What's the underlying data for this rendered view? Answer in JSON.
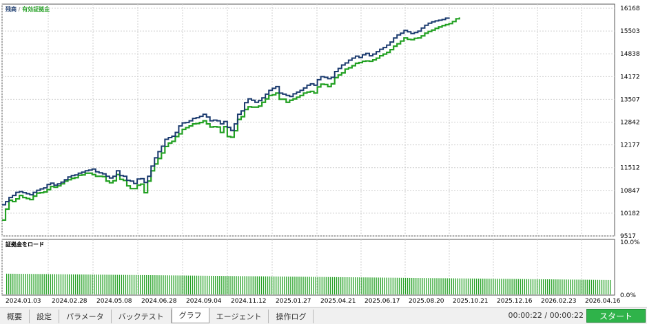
{
  "legend": {
    "balance": "残高",
    "separator": "/",
    "equity": "有効証拠金"
  },
  "load_title": "証拠金をロード",
  "tabs": [
    {
      "label": "概要",
      "active": false
    },
    {
      "label": "設定",
      "active": false
    },
    {
      "label": "パラメータ",
      "active": false
    },
    {
      "label": "バックテスト",
      "active": false
    },
    {
      "label": "グラフ",
      "active": true
    },
    {
      "label": "エージェント",
      "active": false
    },
    {
      "label": "操作ログ",
      "active": false
    }
  ],
  "timer": "00:00:22 / 00:00:22",
  "start_label": "スタート",
  "colors": {
    "balance": "#1a3a6e",
    "equity": "#22a022",
    "grid": "#cfcfcf",
    "load_bar": "#22a022",
    "start_button": "#2fb34a"
  },
  "chart_data": [
    {
      "type": "line",
      "series": [
        {
          "name": "残高",
          "role": "balance"
        },
        {
          "name": "有効証拠金",
          "role": "equity"
        }
      ],
      "y_ticks": [
        9517,
        10182,
        10847,
        11512,
        12177,
        12842,
        13507,
        14172,
        14838,
        15503,
        16168
      ],
      "ylim": [
        9517,
        16168
      ],
      "x_ticks": [
        "2024.01.03",
        "2024.02.28",
        "2024.05.08",
        "2024.06.28",
        "2024.09.04",
        "2024.11.12",
        "2025.01.27",
        "2025.04.21",
        "2025.06.17",
        "2025.08.20",
        "2025.10.21",
        "2025.12.16",
        "2026.02.23",
        "2026.04.16"
      ],
      "x_index": [
        0,
        5,
        10,
        15,
        20,
        25,
        30,
        35,
        40,
        45,
        50,
        55,
        60,
        65,
        70,
        75,
        80,
        85,
        90,
        95,
        100,
        105,
        110,
        115,
        120,
        125,
        130,
        135,
        140,
        145,
        150,
        155,
        160,
        165,
        170,
        175,
        180,
        185,
        190,
        195,
        200,
        205,
        210,
        215,
        220,
        225,
        230,
        235,
        240,
        245,
        250,
        255,
        260,
        265,
        270,
        275,
        280,
        285,
        290,
        295,
        300,
        305,
        310,
        315,
        320,
        325,
        330,
        335,
        340,
        345,
        350,
        355,
        360,
        365,
        370,
        375,
        380,
        385,
        390,
        395,
        400,
        405,
        410,
        415,
        420,
        425,
        430,
        435,
        440,
        445,
        450,
        455,
        460,
        465,
        470,
        475,
        480,
        485,
        490,
        495,
        500,
        505,
        510,
        515,
        520,
        525,
        530,
        535,
        540,
        545,
        550,
        555,
        560,
        565,
        570,
        575,
        580,
        585,
        590,
        595,
        600,
        605,
        610,
        615,
        620,
        625,
        630,
        635,
        640,
        645,
        650,
        655,
        660,
        665,
        670,
        675,
        680,
        685,
        690,
        695,
        700,
        705,
        710,
        715,
        720,
        725,
        730,
        735,
        740,
        745,
        750,
        755,
        760,
        765,
        770,
        775,
        780,
        785,
        790,
        795,
        800,
        805,
        810,
        815,
        820,
        825,
        830,
        835,
        840,
        845,
        850,
        855,
        860,
        865,
        870,
        875,
        880
      ],
      "balance": [
        10430,
        10520,
        10640,
        10700,
        10790,
        10810,
        10780,
        10750,
        10720,
        10790,
        10850,
        10890,
        10920,
        11020,
        11060,
        11000,
        11040,
        11090,
        11160,
        11240,
        11280,
        11300,
        11350,
        11380,
        11420,
        11440,
        11470,
        11390,
        11360,
        11330,
        11260,
        11210,
        11260,
        11420,
        11280,
        11260,
        11140,
        11120,
        11050,
        11180,
        11190,
        11080,
        11260,
        11560,
        11800,
        11980,
        12140,
        12340,
        12390,
        12430,
        12540,
        12730,
        12820,
        12830,
        12880,
        12950,
        12970,
        13010,
        13070,
        12990,
        12880,
        12900,
        12880,
        12790,
        12860,
        12690,
        12600,
        12790,
        13070,
        13170,
        13410,
        13520,
        13480,
        13420,
        13470,
        13550,
        13660,
        13770,
        13830,
        13880,
        13690,
        13660,
        13620,
        13590,
        13670,
        13720,
        13770,
        13840,
        13920,
        13960,
        13920,
        14080,
        14170,
        14150,
        14110,
        14150,
        14320,
        14410,
        14510,
        14570,
        14650,
        14710,
        14770,
        14730,
        14810,
        14850,
        14780,
        14830,
        14900,
        14970,
        15020,
        15090,
        15180,
        15300,
        15390,
        15440,
        15520,
        15480,
        15430,
        15460,
        15500,
        15590,
        15670,
        15730,
        15770,
        15800,
        15820,
        15840,
        15880,
        15900
      ],
      "equity": [
        9980,
        10300,
        10560,
        10520,
        10600,
        10700,
        10640,
        10610,
        10580,
        10680,
        10770,
        10780,
        10800,
        10870,
        10960,
        10940,
        10980,
        11040,
        11120,
        11160,
        11200,
        11220,
        11290,
        11300,
        11350,
        11350,
        11310,
        11260,
        11260,
        11250,
        11120,
        11070,
        11130,
        11310,
        11170,
        11140,
        10980,
        10900,
        10900,
        11000,
        11030,
        10780,
        11120,
        11420,
        11620,
        11780,
        11940,
        12130,
        12230,
        12280,
        12420,
        12500,
        12630,
        12680,
        12730,
        12790,
        12800,
        12830,
        12880,
        12790,
        12700,
        12710,
        12700,
        12540,
        12710,
        12420,
        12400,
        12590,
        12920,
        13000,
        13210,
        13290,
        13280,
        13280,
        13310,
        13420,
        13520,
        13620,
        13640,
        13690,
        13510,
        13510,
        13420,
        13480,
        13520,
        13570,
        13620,
        13690,
        13720,
        13740,
        13690,
        13870,
        13950,
        13940,
        13880,
        13960,
        14140,
        14220,
        14280,
        14390,
        14430,
        14490,
        14560,
        14580,
        14620,
        14630,
        14620,
        14660,
        14710,
        14780,
        14830,
        14880,
        14960,
        15060,
        15130,
        15210,
        15300,
        15260,
        15250,
        15290,
        15300,
        15360,
        15440,
        15490,
        15530,
        15580,
        15620,
        15660,
        15690,
        15720,
        15780,
        15860,
        15900
      ]
    },
    {
      "type": "bar",
      "name": "証拠金をロード",
      "y_ticks": [
        "10.0%",
        "0.0%"
      ],
      "ylim": [
        0,
        10
      ],
      "values_start": 4.1,
      "values_end": 2.9
    }
  ]
}
